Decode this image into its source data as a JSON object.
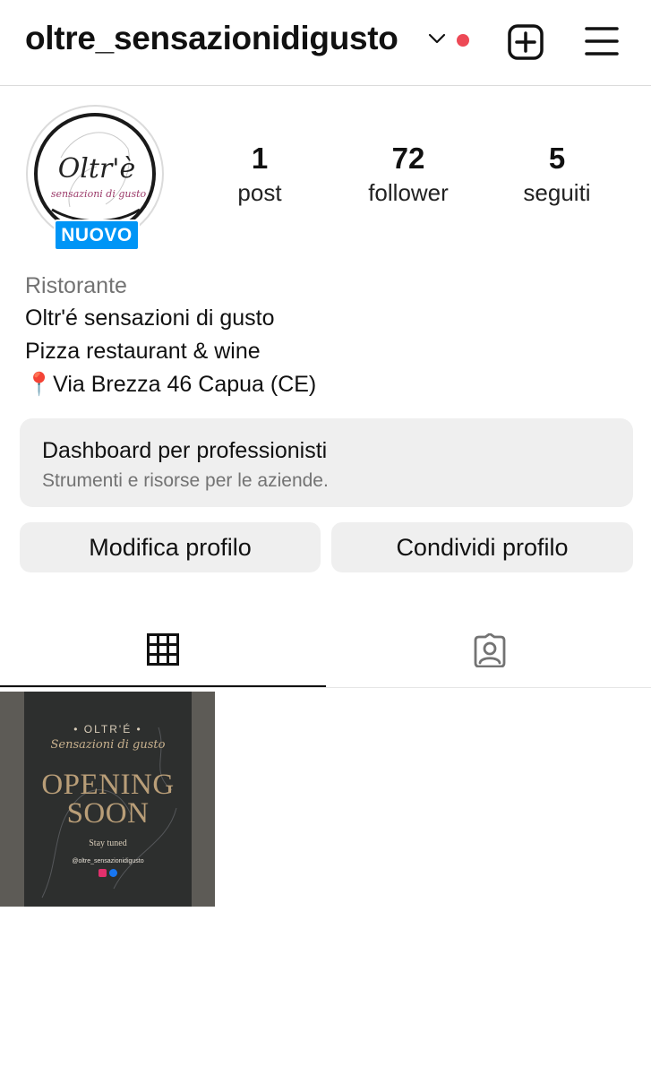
{
  "header": {
    "username": "oltre_sensazionidigusto",
    "has_notification_dot": true,
    "notification_color": "#ed4956",
    "icons": [
      "chevron-down-icon",
      "create-plus-icon",
      "menu-icon"
    ]
  },
  "profile": {
    "avatar_logo_lines": [
      "Oltr'è",
      "sensazioni di gusto"
    ],
    "badge": "NUOVO",
    "badge_color": "#0095f6",
    "stats": [
      {
        "value": "1",
        "label": "post"
      },
      {
        "value": "72",
        "label": "follower"
      },
      {
        "value": "5",
        "label": "seguiti"
      }
    ],
    "category": "Ristorante",
    "bio_lines": [
      "Oltr'é sensazioni di gusto",
      "Pizza restaurant & wine",
      "📍Via Brezza 46 Capua (CE)"
    ]
  },
  "dashboard": {
    "title": "Dashboard per professionisti",
    "subtitle": "Strumenti e risorse per le aziende."
  },
  "actions": {
    "edit": "Modifica profilo",
    "share": "Condividi profilo"
  },
  "tabs": [
    {
      "icon": "grid-icon",
      "active": true
    },
    {
      "icon": "tagged-person-icon",
      "active": false
    }
  ],
  "posts": [
    {
      "brand": "• OLTR'É •",
      "script": "Sensazioni di gusto",
      "headline_lines": [
        "OPENING",
        "SOON"
      ],
      "tagline": "Stay tuned",
      "handle": "@oltre_sensazionidigusto"
    }
  ]
}
